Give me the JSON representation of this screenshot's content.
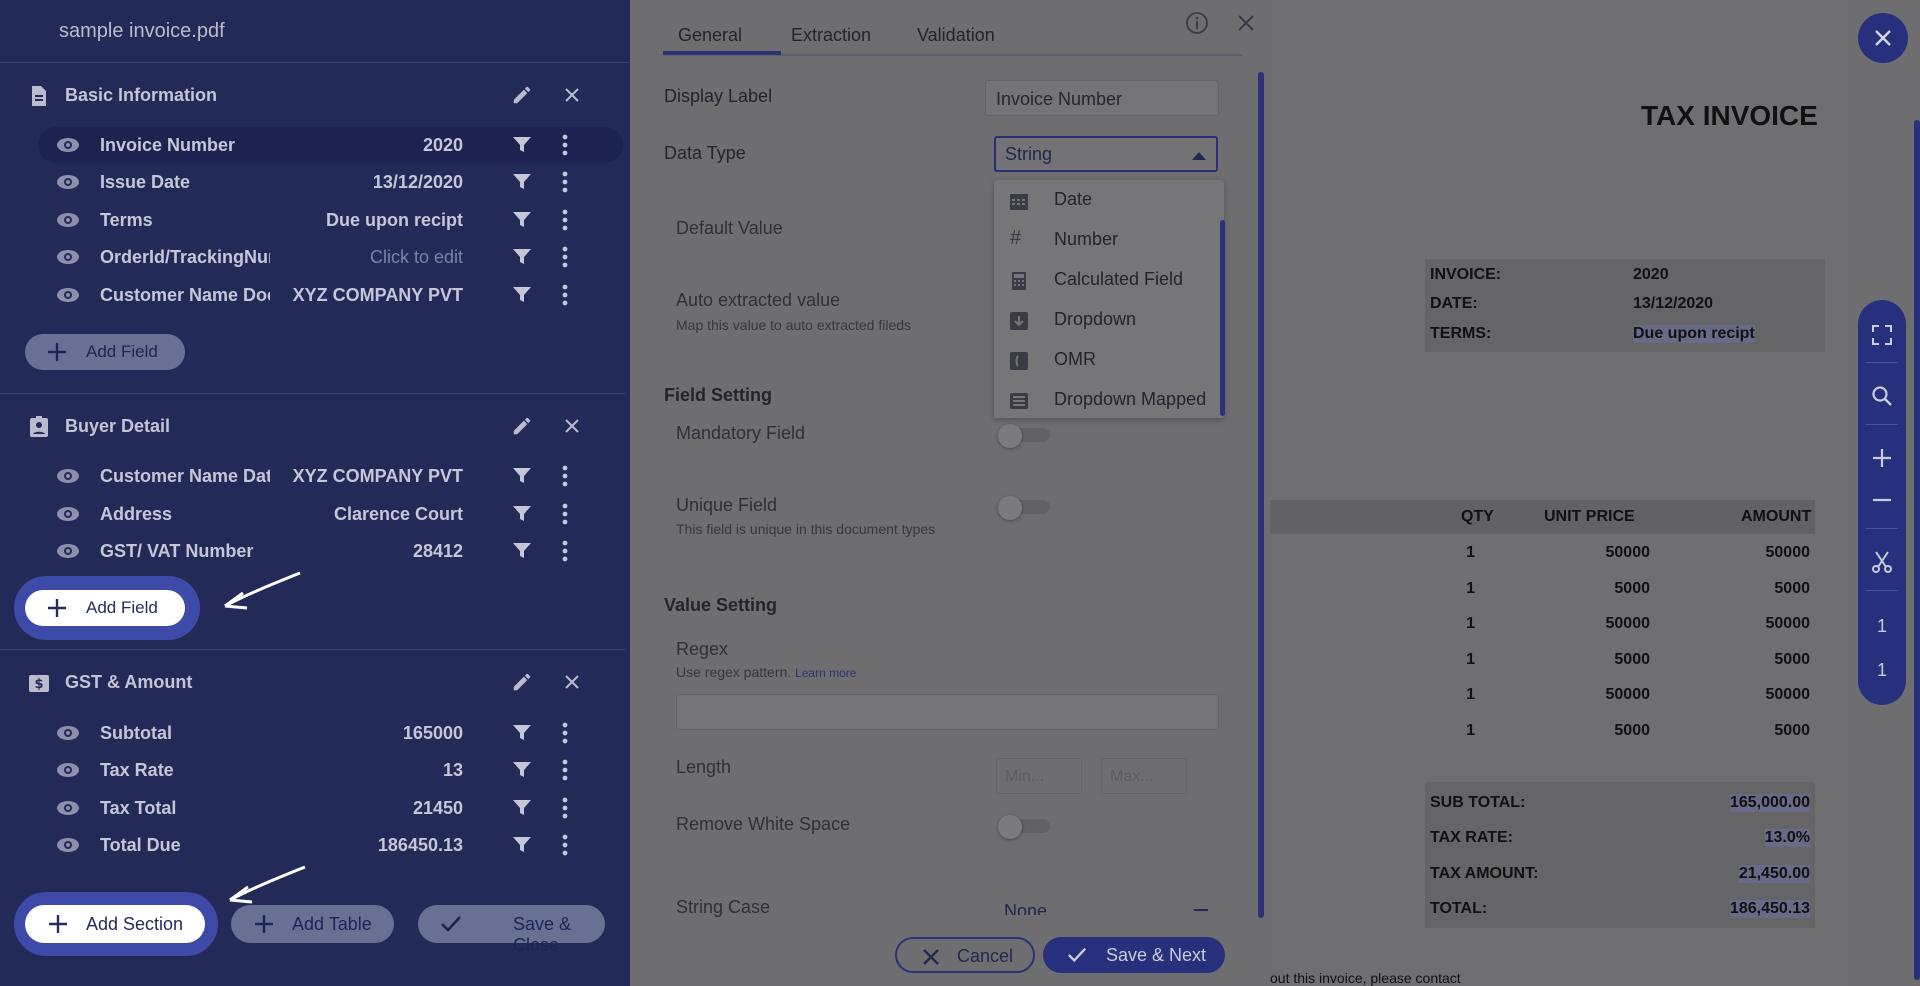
{
  "sidebar": {
    "file_title": "sample invoice.pdf",
    "sections": [
      {
        "title": "Basic Information",
        "fields": [
          {
            "name": "Invoice Number",
            "value": "2020"
          },
          {
            "name": "Issue Date",
            "value": "13/12/2020"
          },
          {
            "name": "Terms",
            "value": "Due upon recipt"
          },
          {
            "name": "OrderId/TrackingNum",
            "value": "Click to edit"
          },
          {
            "name": "Customer Name Document",
            "value": "XYZ COMPANY PVT"
          }
        ],
        "add_field_label": "Add Field"
      },
      {
        "title": "Buyer Detail",
        "fields": [
          {
            "name": "Customer Name Data",
            "value": "XYZ COMPANY PVT"
          },
          {
            "name": "Address",
            "value": "Clarence Court"
          },
          {
            "name": "GST/ VAT Number",
            "value": "28412"
          }
        ],
        "add_field_label": "Add Field"
      },
      {
        "title": "GST & Amount",
        "fields": [
          {
            "name": "Subtotal",
            "value": "165000"
          },
          {
            "name": "Tax Rate",
            "value": "13"
          },
          {
            "name": "Tax Total",
            "value": "21450"
          },
          {
            "name": "Total Due",
            "value": "186450.13"
          }
        ]
      }
    ],
    "bottom_bar": {
      "add_section_label": "Add Section",
      "add_table_label": "Add Table",
      "save_close_label": "Save & Close"
    }
  },
  "config_panel": {
    "tabs": [
      "General",
      "Extraction",
      "Validation"
    ],
    "active_tab": "General",
    "display_label": {
      "label": "Display Label",
      "value": "Invoice Number"
    },
    "data_type": {
      "label": "Data Type",
      "value": "String"
    },
    "data_type_options": [
      "Date",
      "Number",
      "Calculated Field",
      "Dropdown",
      "OMR",
      "Dropdown Mapped"
    ],
    "default_value": {
      "label": "Default Value"
    },
    "auto_extracted": {
      "label": "Auto extracted value",
      "hint": "Map this value to auto extracted fileds"
    },
    "field_setting": {
      "title": "Field Setting",
      "mandatory_label": "Mandatory Field",
      "unique_label": "Unique Field",
      "unique_hint": "This field is unique in this document types"
    },
    "value_setting": {
      "title": "Value Setting",
      "regex_label": "Regex",
      "regex_hint": "Use regex pattern.",
      "regex_link": "Learn more",
      "length_label": "Length",
      "min_placeholder": "Min...",
      "max_placeholder": "Max...",
      "remove_ws_label": "Remove White Space",
      "string_case_label": "String Case",
      "string_case_value": "None"
    },
    "footer": {
      "cancel_label": "Cancel",
      "save_next_label": "Save & Next"
    }
  },
  "document": {
    "title": "TAX INVOICE",
    "info": [
      {
        "key": "INVOICE:",
        "value": "2020"
      },
      {
        "key": "DATE:",
        "value": "13/12/2020"
      },
      {
        "key": "TERMS:",
        "value": "Due upon recipt"
      }
    ],
    "table_headers": [
      "QTY",
      "UNIT PRICE",
      "AMOUNT"
    ],
    "table_rows": [
      {
        "qty": "1",
        "unit_price": "50000",
        "amount": "50000"
      },
      {
        "qty": "1",
        "unit_price": "5000",
        "amount": "5000"
      },
      {
        "qty": "1",
        "unit_price": "50000",
        "amount": "50000"
      },
      {
        "qty": "1",
        "unit_price": "5000",
        "amount": "5000"
      },
      {
        "qty": "1",
        "unit_price": "50000",
        "amount": "50000"
      },
      {
        "qty": "1",
        "unit_price": "5000",
        "amount": "5000"
      }
    ],
    "totals": [
      {
        "key": "SUB TOTAL:",
        "value": "165,000.00"
      },
      {
        "key": "TAX RATE:",
        "value": "13.0%"
      },
      {
        "key": "TAX AMOUNT:",
        "value": "21,450.00"
      },
      {
        "key": "TOTAL:",
        "value": "186,450.13"
      }
    ],
    "footer_text": "out this invoice, please contact"
  },
  "toolbar": {
    "page_current": "1",
    "page_total": "1"
  },
  "colors": {
    "sidebar_bg": "#242a58",
    "accent": "#27307c",
    "overlay": "#6e6e70"
  }
}
